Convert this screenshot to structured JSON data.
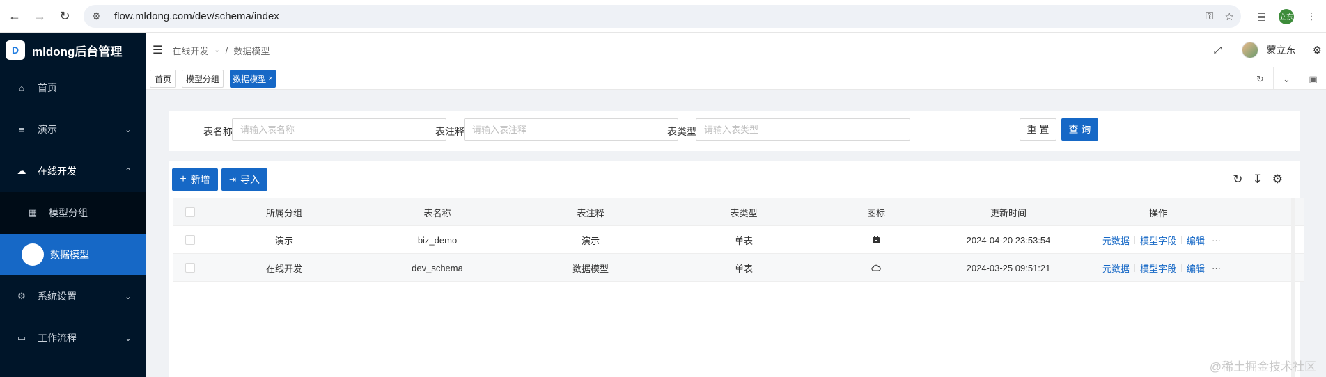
{
  "browser": {
    "url": "flow.mldong.com/dev/schema/index",
    "profile_initials": "立东"
  },
  "sidebar": {
    "app_title": "mldong后台管理",
    "logo_glyph": "D",
    "items": [
      {
        "label": "首页",
        "icon": "home-icon"
      },
      {
        "label": "演示",
        "icon": "menu-lines-icon"
      },
      {
        "label": "在线开发",
        "icon": "cloud-icon"
      },
      {
        "label": "模型分组",
        "icon": "table-icon"
      },
      {
        "label": "数据模型",
        "icon": "circle-icon"
      },
      {
        "label": "系统设置",
        "icon": "gear-icon"
      },
      {
        "label": "工作流程",
        "icon": "monitor-icon"
      }
    ]
  },
  "header": {
    "breadcrumb": [
      "在线开发",
      "数据模型"
    ],
    "breadcrumb_sep": "/",
    "username": "蒙立东"
  },
  "tabs": [
    {
      "label": "首页"
    },
    {
      "label": "模型分组"
    },
    {
      "label": "数据模型",
      "close": "×"
    }
  ],
  "search": {
    "fields": [
      {
        "label": "表名称",
        "placeholder": "请输入表名称"
      },
      {
        "label": "表注释",
        "placeholder": "请输入表注释"
      },
      {
        "label": "表类型",
        "placeholder": "请输入表类型"
      }
    ],
    "reset_label": "重 置",
    "query_label": "查 询"
  },
  "toolbar": {
    "add_label": "新增",
    "import_label": "导入"
  },
  "table": {
    "columns": [
      "所属分组",
      "表名称",
      "表注释",
      "表类型",
      "图标",
      "更新时间",
      "操作"
    ],
    "rows": [
      {
        "group": "演示",
        "name": "biz_demo",
        "comment": "演示",
        "type": "单表",
        "icon": "calendar-icon",
        "updated": "2024-04-20 23:53:54"
      },
      {
        "group": "在线开发",
        "name": "dev_schema",
        "comment": "数据模型",
        "type": "单表",
        "icon": "cloud-icon",
        "updated": "2024-03-25 09:51:21"
      }
    ],
    "actions": [
      "元数据",
      "模型字段",
      "编辑",
      "···"
    ]
  },
  "watermark": "@稀土掘金技术社区",
  "colors": {
    "primary": "#1668c6",
    "sidebar_bg": "#001529"
  }
}
